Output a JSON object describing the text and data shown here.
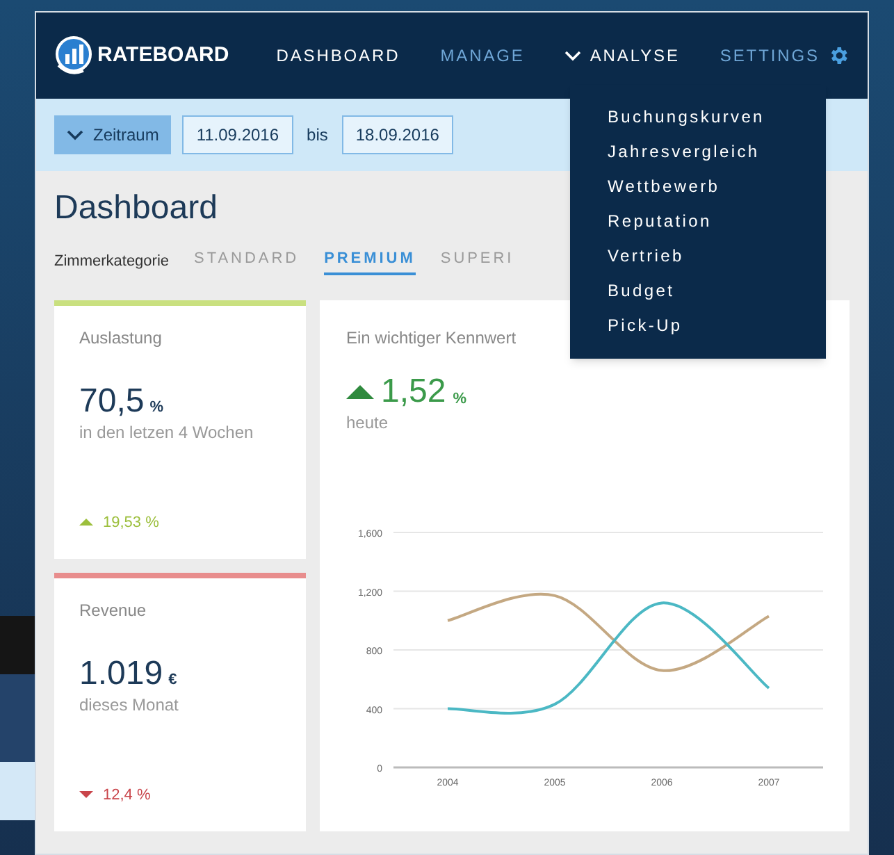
{
  "brand": {
    "name": "RATEBOARD"
  },
  "nav": [
    {
      "label": "DASHBOARD",
      "kind": "link",
      "selected": true
    },
    {
      "label": "MANAGE",
      "kind": "link",
      "selected": false
    },
    {
      "label": "ANALYSE",
      "kind": "menu",
      "selected": true,
      "expanded": true
    },
    {
      "label": "SETTINGS",
      "kind": "settings",
      "selected": false
    }
  ],
  "analyse_menu": [
    "Buchungskurven",
    "Jahresvergleich",
    "Wettbewerb",
    "Reputation",
    "Vertrieb",
    "Budget",
    "Pick-Up"
  ],
  "filter": {
    "button": "Zeitraum",
    "from": "11.09.2016",
    "separator": "bis",
    "to": "18.09.2016"
  },
  "page_title": "Dashboard",
  "category": {
    "label": "Zimmerkategorie",
    "tabs": [
      {
        "label": "STANDARD",
        "selected": false
      },
      {
        "label": "PREMIUM",
        "selected": true
      },
      {
        "label": "SUPERI",
        "selected": false
      }
    ]
  },
  "kpis": [
    {
      "title": "Auslastung",
      "value": "70,5",
      "unit": "%",
      "caption": "in den letzen 4 Wochen",
      "kind": "up",
      "change": "19,53 %",
      "color": "#c9e07f"
    },
    {
      "title": "Revenue",
      "value": "1.019",
      "unit": "€",
      "caption": "dieses Monat",
      "kind": "down",
      "change": "12,4 %",
      "color": "#e88d8d"
    }
  ],
  "chart_card": {
    "title": "Ein wichtiger Kennwert",
    "kind": "up",
    "value": "1,52",
    "unit": "%",
    "caption": "heute",
    "chart_data": {
      "type": "line",
      "grid": true,
      "categories": [
        "2004",
        "2005",
        "2006",
        "2007"
      ],
      "series": [
        {
          "color": "#c4a882",
          "values": [
            1000,
            1170,
            660,
            1030
          ]
        },
        {
          "color": "#4bb8c4",
          "values": [
            400,
            430,
            1120,
            540
          ]
        }
      ],
      "ylim": [
        0,
        1600
      ],
      "yticks": [
        0,
        {
          "value": 400,
          "label": "400"
        },
        {
          "value": 800,
          "label": "800"
        },
        {
          "value": 1200,
          "label": "1,200"
        },
        {
          "value": 1600,
          "label": "1,600"
        }
      ]
    }
  }
}
